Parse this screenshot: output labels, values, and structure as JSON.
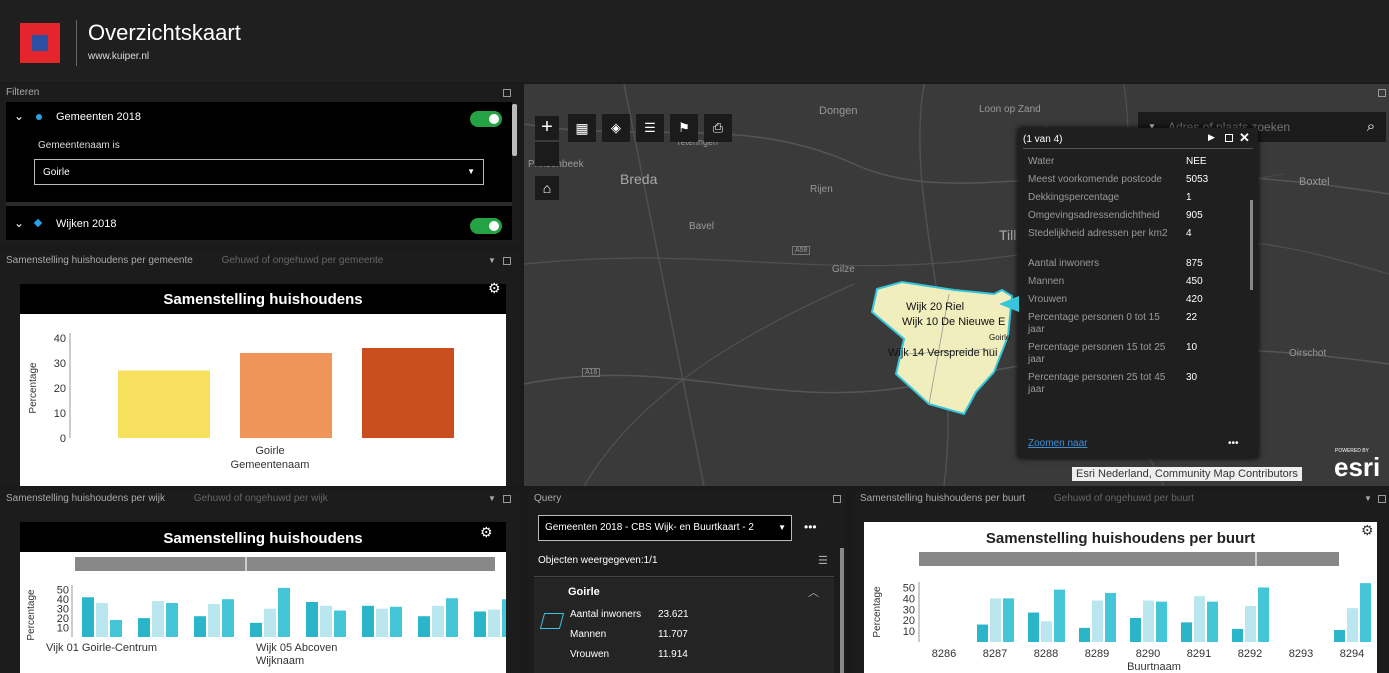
{
  "app": {
    "title": "Overzichtskaart",
    "subtitle": "www.kuiper.nl"
  },
  "filter": {
    "header": "Filteren",
    "layer1": {
      "name": "Gemeenten 2018",
      "label": "Gemeentenaam is",
      "value": "Goirle"
    },
    "layer2": {
      "name": "Wijken 2018"
    }
  },
  "panel_gemeente": {
    "tab1": "Samenstelling huishoudens per gemeente",
    "tab2": "Gehuwd of ongehuwd per gemeente"
  },
  "panel_wijk": {
    "tab1": "Samenstelling huishoudens per wijk",
    "tab2": "Gehuwd of ongehuwd per wijk"
  },
  "panel_buurt": {
    "tab1": "Samenstelling huishoudens per buurt",
    "tab2": "Gehuwd of ongehuwd per buurt"
  },
  "query": {
    "header": "Query",
    "select_value": "Gemeenten 2018 - CBS Wijk- en Buurtkaart - 2",
    "count_label": "Objecten weergegeven:1/1",
    "result_title": "Goirle",
    "rows": [
      {
        "label": "Aantal inwoners",
        "value": "23.621"
      },
      {
        "label": "Mannen",
        "value": "11.707"
      },
      {
        "label": "Vrouwen",
        "value": "11.914"
      }
    ]
  },
  "map": {
    "search_placeholder": "Adres of plaats zoeken",
    "attribution": "Esri Nederland, Community Map Contributors",
    "powered_by": "POWERED BY",
    "esri": "esri",
    "places": [
      "Dongen",
      "Loon op Zand",
      "Prinsenbeek",
      "Teteringen",
      "Breda",
      "Rijen",
      "Boxtel",
      "Bavel",
      "Gilze",
      "Till",
      "Oirschot",
      "A58",
      "A16"
    ],
    "polygon_labels": [
      "Wijk 20 Riel",
      "Wijk 10 De Nieuwe E",
      "Goirle",
      "Wijk 14 Verspreide hui"
    ]
  },
  "popup": {
    "title": "(1 van 4)",
    "zoom_link": "Zoomen naar",
    "more": "•••",
    "rows": [
      {
        "label": "Water",
        "value": "NEE"
      },
      {
        "label": "Meest voorkomende postcode",
        "value": "5053"
      },
      {
        "label": "Dekkingspercentage",
        "value": "1"
      },
      {
        "label": "Omgevingsadressendichtheid",
        "value": "905"
      },
      {
        "label": "Stedelijkheid adressen per km2",
        "value": "4"
      },
      {
        "label": "Aantal inwoners",
        "value": "875"
      },
      {
        "label": "Mannen",
        "value": "450"
      },
      {
        "label": "Vrouwen",
        "value": "420"
      },
      {
        "label": "Percentage personen 0 tot 15 jaar",
        "value": "22"
      },
      {
        "label": "Percentage personen 15 tot 25 jaar",
        "value": "10"
      },
      {
        "label": "Percentage personen 25 tot 45 jaar",
        "value": "30"
      }
    ]
  },
  "chart_data": [
    {
      "type": "bar",
      "title": "Samenstelling huishoudens",
      "xlabel": "Gemeentenaam",
      "ylabel": "Percentage",
      "categories": [
        "Goirle"
      ],
      "yticks": [
        "0",
        "10",
        "20",
        "30",
        "40"
      ],
      "ylim": [
        0,
        40
      ],
      "values": [
        27,
        34,
        36
      ],
      "colors": [
        "#f6e05e",
        "#f0955a",
        "#c9501e"
      ]
    },
    {
      "type": "bar",
      "title": "Samenstelling huishoudens",
      "xlabel": "Wijknaam",
      "ylabel": "Percentage",
      "tick_labels": [
        "Vijk 01 Goirle-Centrum",
        "Wijk 05 Abcoven"
      ],
      "yticks": [
        "10",
        "20",
        "30",
        "40",
        "50"
      ],
      "ylim": [
        0,
        55
      ],
      "values": [
        42,
        36,
        18,
        0,
        20,
        38,
        36,
        0,
        22,
        35,
        40,
        0,
        15,
        30,
        52,
        0,
        37,
        33,
        28,
        0,
        33,
        30,
        32,
        0,
        22,
        33,
        41,
        0,
        27,
        29,
        40
      ],
      "colors": [
        "#2bb5c8",
        "#b9e6ef",
        "#45c6d8"
      ]
    },
    {
      "type": "bar",
      "title": "Samenstelling huishoudens per buurt",
      "xlabel": "Buurtnaam",
      "ylabel": "Percentage",
      "categories": [
        "8286",
        "8287",
        "8288",
        "8289",
        "8290",
        "8291",
        "8292",
        "8293",
        "8294"
      ],
      "yticks": [
        "10",
        "20",
        "30",
        "40",
        "50"
      ],
      "ylim": [
        0,
        55
      ],
      "series": [
        {
          "values": [
            0,
            16,
            27,
            13,
            22,
            18,
            12,
            0,
            11
          ]
        },
        {
          "values": [
            0,
            40,
            19,
            38,
            38,
            42,
            33,
            0,
            31
          ]
        },
        {
          "values": [
            0,
            40,
            48,
            45,
            37,
            37,
            50,
            0,
            54
          ]
        }
      ],
      "colors": [
        "#2bb5c8",
        "#b9e6ef",
        "#45c6d8"
      ]
    }
  ]
}
